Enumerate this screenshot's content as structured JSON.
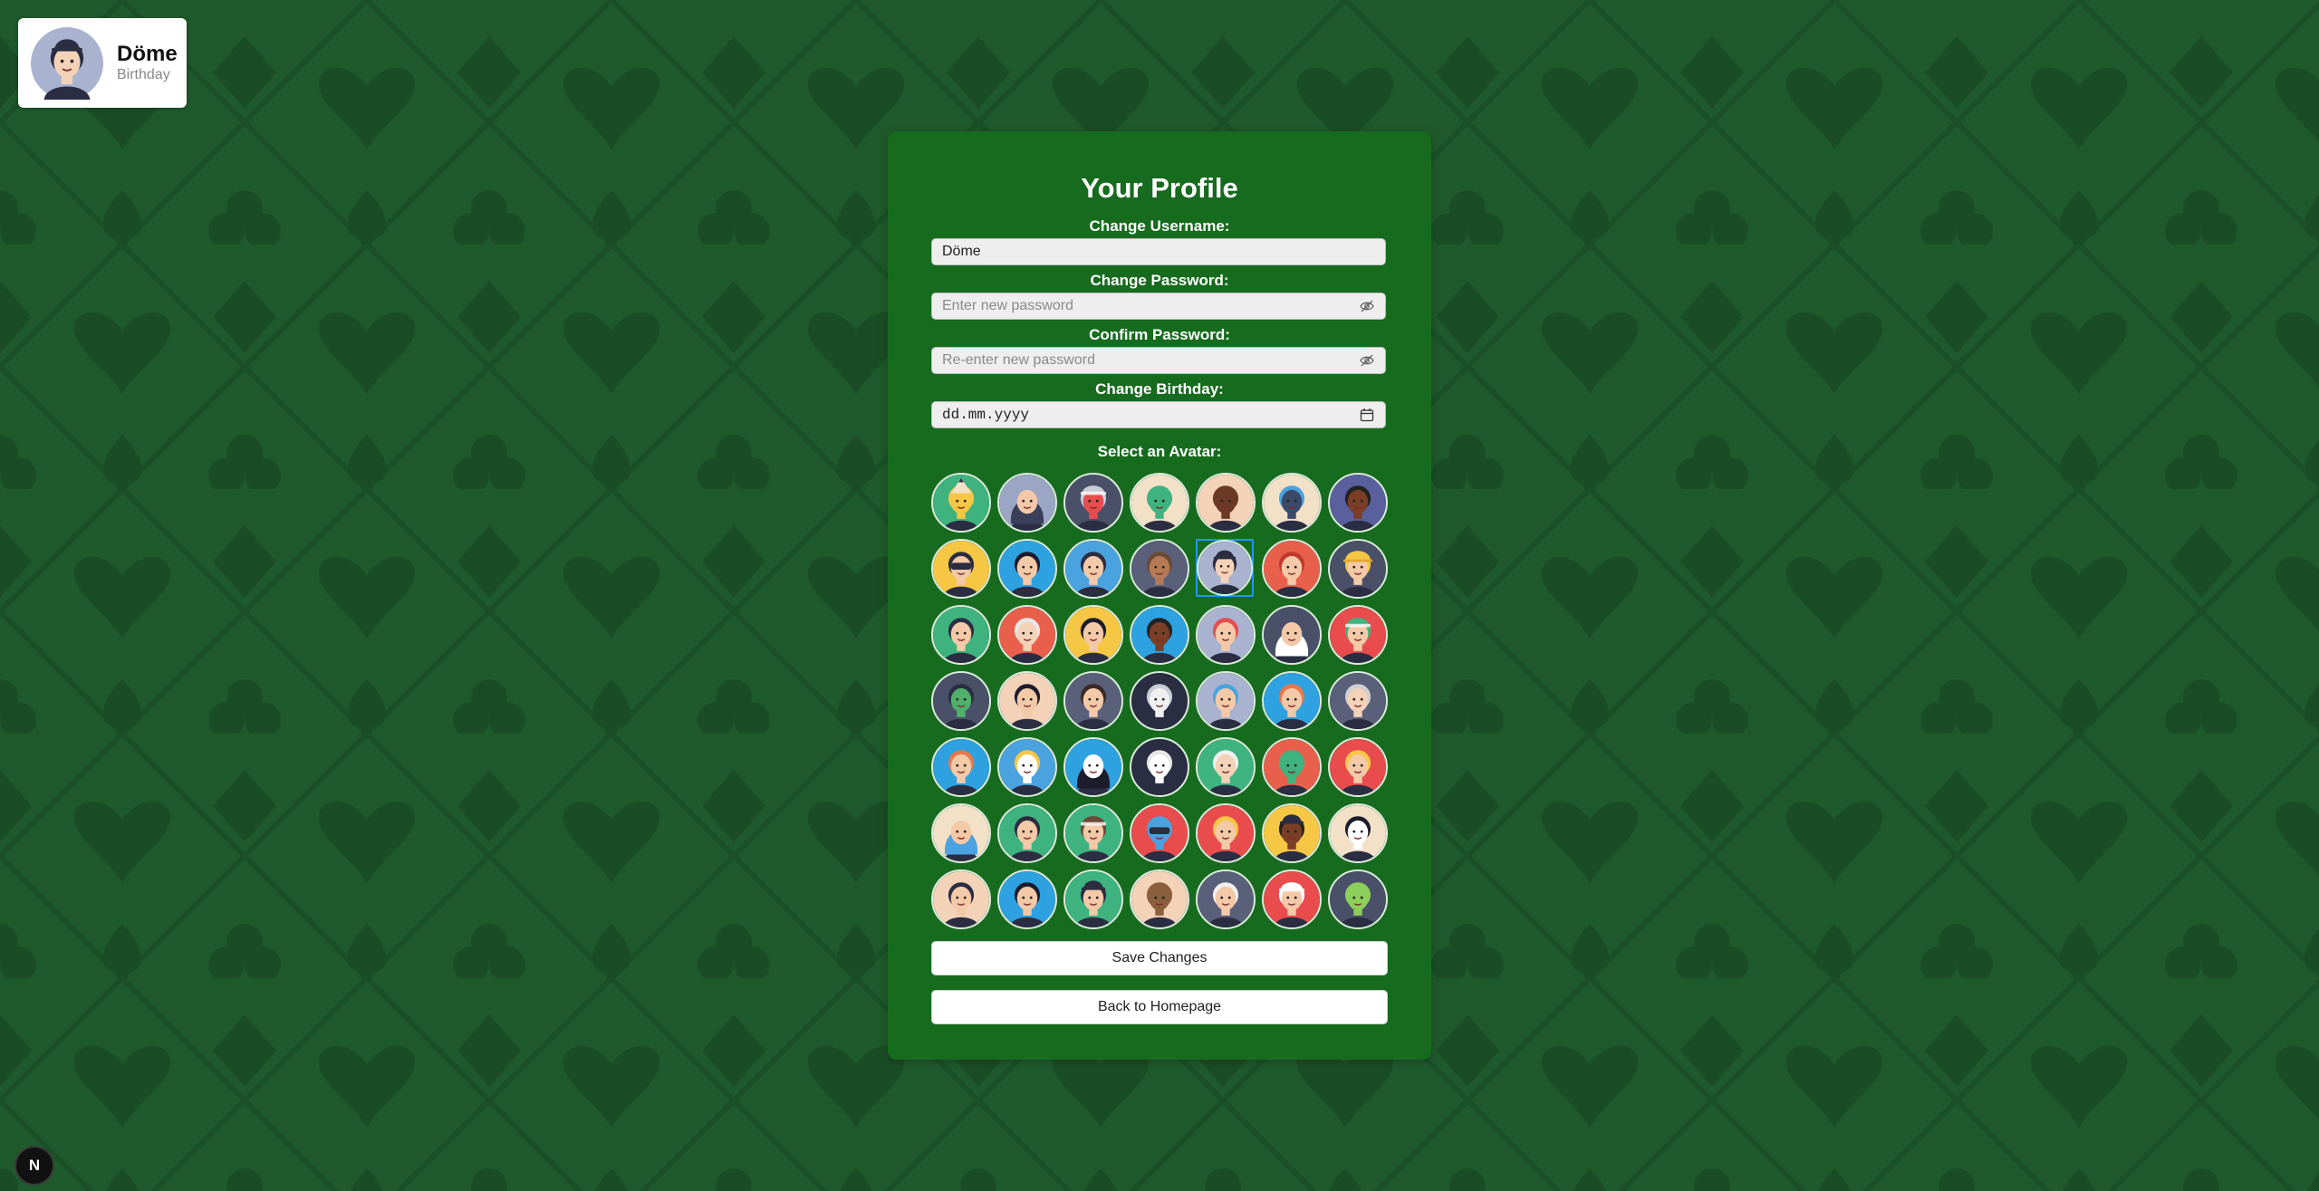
{
  "user_card": {
    "username": "Döme",
    "subtitle": "Birthday",
    "avatar": "chef-hat-man-avatar"
  },
  "profile": {
    "title": "Your Profile",
    "username_label": "Change Username:",
    "username_value": "Döme",
    "password_label": "Change Password:",
    "password_placeholder": "Enter new password",
    "confirm_label": "Confirm Password:",
    "confirm_placeholder": "Re-enter new password",
    "birthday_label": "Change Birthday:",
    "birthday_value": "dd.mm.yyyy",
    "avatar_label": "Select an Avatar:",
    "selected_avatar_index": 11,
    "save_label": "Save Changes",
    "back_label": "Back to Homepage"
  },
  "icons": {
    "password_toggle": "eye-off-icon",
    "calendar": "calendar-icon"
  },
  "avatars": [
    {
      "name": "pencil-avatar",
      "bg": "#3fb37f",
      "skin": "#f6c744",
      "hair": "#f6c744",
      "hat": "pencil"
    },
    {
      "name": "hijab-woman-avatar",
      "bg": "#9aa6c4",
      "skin": "#f3c9a8",
      "hair": "#3a3f5c",
      "hat": "hood"
    },
    {
      "name": "robot-bandana-avatar",
      "bg": "#4a5068",
      "skin": "#e84c4c",
      "hair": "#c7ccd6",
      "hat": "cap"
    },
    {
      "name": "cactus-avatar",
      "bg": "#f3e1c7",
      "skin": "#3fb37f",
      "hair": "#3fb37f",
      "hat": "none"
    },
    {
      "name": "bald-man-avatar",
      "bg": "#f3d2b8",
      "skin": "#6b3a26",
      "hair": "#6b3a26",
      "hat": "none"
    },
    {
      "name": "monster-avatar",
      "bg": "#f3e1c7",
      "skin": "#3a4a6b",
      "hair": "#4aa3df",
      "hat": "none"
    },
    {
      "name": "curly-hair-man-avatar",
      "bg": "#5a5f9e",
      "skin": "#7a3f26",
      "hair": "#222",
      "hat": "none"
    },
    {
      "name": "batman-avatar",
      "bg": "#f6c744",
      "skin": "#f3c9a8",
      "hair": "#2b2d42",
      "hat": "mask"
    },
    {
      "name": "dark-hair-woman-avatar",
      "bg": "#2ea1e0",
      "skin": "#f3c9a8",
      "hair": "#1c1c2b",
      "hat": "none"
    },
    {
      "name": "bearded-man-avatar",
      "bg": "#4aa3df",
      "skin": "#f3c9a8",
      "hair": "#2b2d42",
      "hat": "none"
    },
    {
      "name": "sloth-avatar",
      "bg": "#5a5f7a",
      "skin": "#b57a55",
      "hair": "#6b4a36",
      "hat": "none"
    },
    {
      "name": "chef-hat-man-avatar",
      "bg": "#a9b3cf",
      "skin": "#f3d2b8",
      "hair": "#2b2d42",
      "hat": "bowler"
    },
    {
      "name": "red-hair-woman-avatar",
      "bg": "#e8604c",
      "skin": "#f3c9a8",
      "hair": "#c0392b",
      "hat": "none"
    },
    {
      "name": "builder-avatar",
      "bg": "#4a5068",
      "skin": "#f3c9a8",
      "hair": "#f6c744",
      "hat": "helmet"
    },
    {
      "name": "bun-woman-avatar",
      "bg": "#3fb37f",
      "skin": "#f3c9a8",
      "hair": "#2b2d42",
      "hat": "none"
    },
    {
      "name": "grandma-avatar",
      "bg": "#e8604c",
      "skin": "#f3d2b8",
      "hair": "#e6e6e6",
      "hat": "none"
    },
    {
      "name": "long-hair-woman-avatar",
      "bg": "#f6c744",
      "skin": "#f3c9a8",
      "hair": "#1c1c2b",
      "hat": "none"
    },
    {
      "name": "afro-man-avatar",
      "bg": "#2ea1e0",
      "skin": "#7a3f26",
      "hair": "#222",
      "hat": "none"
    },
    {
      "name": "punk-man-avatar",
      "bg": "#a9b3cf",
      "skin": "#f3c9a8",
      "hair": "#e84c4c",
      "hat": "none"
    },
    {
      "name": "keffiyeh-man-avatar",
      "bg": "#4a5068",
      "skin": "#f3c9a8",
      "hair": "#ffffff",
      "hat": "hood"
    },
    {
      "name": "green-cap-boy-avatar",
      "bg": "#e84c4c",
      "skin": "#f3c9a8",
      "hair": "#3fb37f",
      "hat": "cap"
    },
    {
      "name": "zombie-avatar",
      "bg": "#4a5068",
      "skin": "#4fb06b",
      "hair": "#2b2d42",
      "hat": "none"
    },
    {
      "name": "short-hair-woman-avatar",
      "bg": "#f3d2b8",
      "skin": "#f3c9a8",
      "hair": "#1c1c2b",
      "hat": "none"
    },
    {
      "name": "glasses-woman-avatar",
      "bg": "#5a5f7a",
      "skin": "#f3c9a8",
      "hair": "#3a2a26",
      "hat": "none"
    },
    {
      "name": "hockey-mask-avatar",
      "bg": "#2b2d42",
      "skin": "#f0f0f0",
      "hair": "#c7ccd6",
      "hat": "none"
    },
    {
      "name": "old-woman-avatar",
      "bg": "#a9b3cf",
      "skin": "#f3c9a8",
      "hair": "#4aa3df",
      "hat": "none"
    },
    {
      "name": "ginger-boy-avatar",
      "bg": "#2ea1e0",
      "skin": "#f3c9a8",
      "hair": "#e8784c",
      "hat": "none"
    },
    {
      "name": "bald-old-man-avatar",
      "bg": "#5a5f7a",
      "skin": "#f3d2b8",
      "hair": "#d0d0d0",
      "hat": "none"
    },
    {
      "name": "orange-hair-boy-avatar",
      "bg": "#2ea1e0",
      "skin": "#f3c9a8",
      "hair": "#e8784c",
      "hat": "none"
    },
    {
      "name": "rainbow-cloud-avatar",
      "bg": "#4aa3df",
      "skin": "#ffffff",
      "hair": "#f6c744",
      "hat": "none"
    },
    {
      "name": "no-face-avatar",
      "bg": "#2ea1e0",
      "skin": "#ffffff",
      "hair": "#1c1c2b",
      "hat": "hood"
    },
    {
      "name": "sheep-avatar",
      "bg": "#2b2d42",
      "skin": "#ffffff",
      "hair": "#e6e6e6",
      "hat": "none"
    },
    {
      "name": "einstein-avatar",
      "bg": "#3fb37f",
      "skin": "#f3d2b8",
      "hair": "#f0f0f0",
      "hat": "none"
    },
    {
      "name": "alien-avatar",
      "bg": "#e8604c",
      "skin": "#3fb37f",
      "hair": "#3fb37f",
      "hat": "none"
    },
    {
      "name": "blonde-woman-avatar",
      "bg": "#e84c4c",
      "skin": "#f3c9a8",
      "hair": "#f6c744",
      "hat": "none"
    },
    {
      "name": "santa-woman-avatar",
      "bg": "#f3e1c7",
      "skin": "#f3c9a8",
      "hair": "#4aa3df",
      "hat": "hood"
    },
    {
      "name": "headband-boy-avatar",
      "bg": "#3fb37f",
      "skin": "#f3c9a8",
      "hair": "#2b2d42",
      "hat": "none"
    },
    {
      "name": "pilot-avatar",
      "bg": "#3fb37f",
      "skin": "#f3c9a8",
      "hair": "#6b4a36",
      "hat": "cap"
    },
    {
      "name": "luchador-avatar",
      "bg": "#e84c4c",
      "skin": "#4aa3df",
      "hair": "#4aa3df",
      "hat": "mask"
    },
    {
      "name": "blonde-man-avatar",
      "bg": "#e84c4c",
      "skin": "#f3c9a8",
      "hair": "#f6c744",
      "hat": "none"
    },
    {
      "name": "top-hat-man-avatar",
      "bg": "#f6c744",
      "skin": "#7a3f26",
      "hair": "#222",
      "hat": "bowler"
    },
    {
      "name": "geisha-avatar",
      "bg": "#f3e1c7",
      "skin": "#ffffff",
      "hair": "#1c1c2b",
      "hat": "none"
    },
    {
      "name": "braids-woman-avatar",
      "bg": "#f3d2b8",
      "skin": "#f3c9a8",
      "hair": "#2b2d42",
      "hat": "none"
    },
    {
      "name": "glasses-man-avatar",
      "bg": "#2ea1e0",
      "skin": "#f3c9a8",
      "hair": "#1c1c2b",
      "hat": "none"
    },
    {
      "name": "heisenberg-avatar",
      "bg": "#3fb37f",
      "skin": "#f3c9a8",
      "hair": "#2b2d42",
      "hat": "bowler"
    },
    {
      "name": "bear-avatar",
      "bg": "#f3d2b8",
      "skin": "#8b5e3c",
      "hair": "#8b5e3c",
      "hat": "none"
    },
    {
      "name": "white-hair-woman-avatar",
      "bg": "#5a5f7a",
      "skin": "#f3c9a8",
      "hair": "#f0f0f0",
      "hat": "none"
    },
    {
      "name": "santa-avatar",
      "bg": "#e84c4c",
      "skin": "#f3c9a8",
      "hair": "#ffffff",
      "hat": "cap"
    },
    {
      "name": "avocado-avatar",
      "bg": "#4a5068",
      "skin": "#8ccf5a",
      "hair": "#8ccf5a",
      "hat": "none"
    }
  ]
}
